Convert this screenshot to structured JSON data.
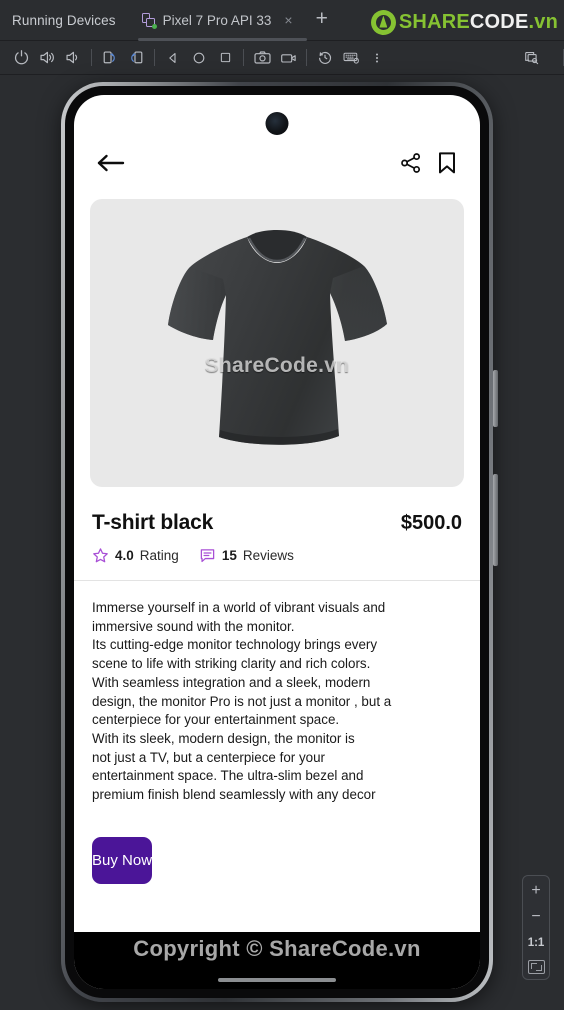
{
  "window": {
    "title": "Running Devices",
    "tabs": [
      {
        "label": "Pixel 7 Pro API 33",
        "close": "×",
        "active": true
      }
    ],
    "add_tab": "+",
    "logo": {
      "part_green_1": "SHARE",
      "part_white": "CODE",
      "part_green_2": ".vn"
    }
  },
  "device_toolbar": {
    "items": [
      {
        "name": "power-icon",
        "tooltip": "Power"
      },
      {
        "name": "volume-up-icon",
        "tooltip": "Volume Up"
      },
      {
        "name": "volume-down-icon",
        "tooltip": "Volume Down"
      },
      {
        "name": "rotate-left-icon",
        "tooltip": "Rotate Left"
      },
      {
        "name": "rotate-right-icon",
        "tooltip": "Rotate Right"
      },
      {
        "name": "back-icon",
        "tooltip": "Back"
      },
      {
        "name": "home-icon",
        "tooltip": "Home"
      },
      {
        "name": "overview-icon",
        "tooltip": "Overview"
      },
      {
        "name": "screenshot-icon",
        "tooltip": "Take Screenshot"
      },
      {
        "name": "record-icon",
        "tooltip": "Record Screen"
      },
      {
        "name": "rotate-history-icon",
        "tooltip": "Snapshots"
      },
      {
        "name": "keyboard-icon",
        "tooltip": "Hardware Input"
      },
      {
        "name": "more-icon",
        "tooltip": "More"
      },
      {
        "name": "device-manager-icon",
        "tooltip": "Device Manager"
      }
    ],
    "accent_blue": "#5a87d1"
  },
  "app": {
    "topbar": {
      "back_icon": "back-arrow-icon",
      "share_icon": "share-icon",
      "bookmark_icon": "bookmark-icon"
    },
    "hero": {
      "watermark": "ShareCode.vn",
      "bg_color": "#e8e8e8",
      "product_image": "black-tshirt"
    },
    "product": {
      "title": "T-shirt black",
      "price": "$500.0",
      "rating_value": "4.0",
      "rating_label": "Rating",
      "reviews_value": "15",
      "reviews_label": "Reviews",
      "accent_color": "#a84fd6",
      "description": "Immerse yourself in a world of vibrant visuals and\n immersive sound with the monitor.\nIts cutting-edge monitor technology brings every\n scene to life with striking clarity and rich colors.\n With seamless integration and a sleek, modern\n design, the monitor Pro is not just a monitor , but a\n centerpiece for your entertainment space.\nWith its sleek, modern design, the monitor is\n not just a TV, but a centerpiece for your\nentertainment space. The ultra-slim bezel and\n premium finish blend seamlessly with any decor"
    },
    "buy_button": {
      "label": "Buy Now",
      "color": "#4b1598"
    },
    "footer_watermark": "Copyright © ShareCode.vn"
  },
  "zoom_controls": {
    "zoom_in": "+",
    "zoom_out": "−",
    "ratio": "1:1",
    "fit_icon": "fit-to-screen-icon"
  }
}
